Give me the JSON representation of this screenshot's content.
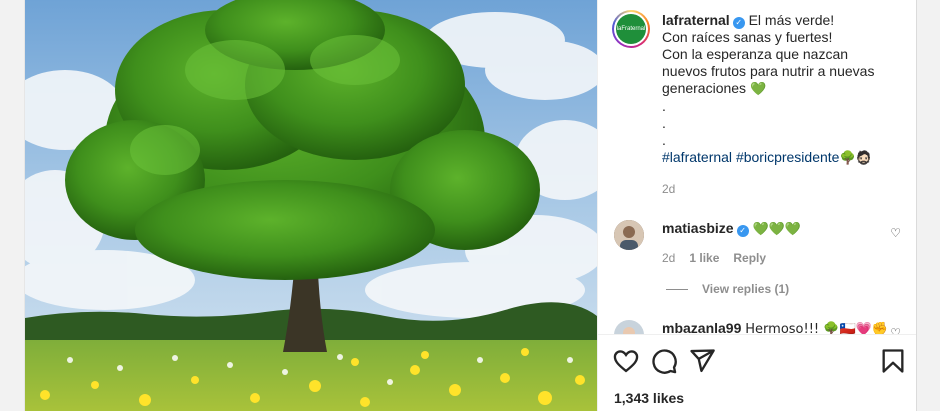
{
  "post": {
    "username": "lafraternal",
    "avatar_text": "laFraternal",
    "caption_lines": [
      "El más verde!",
      "Con raíces sanas y fuertes!",
      "Con la esperanza que nazcan nuevos frutos para nutrir a nuevas generaciones",
      ".",
      ".",
      "."
    ],
    "caption_emoji": "💚",
    "hashtags": [
      "#lafraternal",
      "#boricpresidente"
    ],
    "hashtag_emoji": "🌳🧔🏻",
    "time": "2d"
  },
  "comments": [
    {
      "username": "matiasbize",
      "text": "💚💚💚",
      "time": "2d",
      "likes": "1 like",
      "reply": "Reply",
      "view_replies": "View replies (1)"
    },
    {
      "username": "mbazanla99",
      "text": "Hermoso!!! 🌳🇨🇱💗✊"
    }
  ],
  "footer": {
    "likes": "1,343 likes"
  },
  "icons": {
    "like": "heart-icon",
    "comment": "comment-icon",
    "share": "send-icon",
    "save": "bookmark-icon"
  },
  "colors": {
    "hashtag": "#00376b",
    "verified": "#3897f0",
    "muted": "#8e8e8e"
  }
}
